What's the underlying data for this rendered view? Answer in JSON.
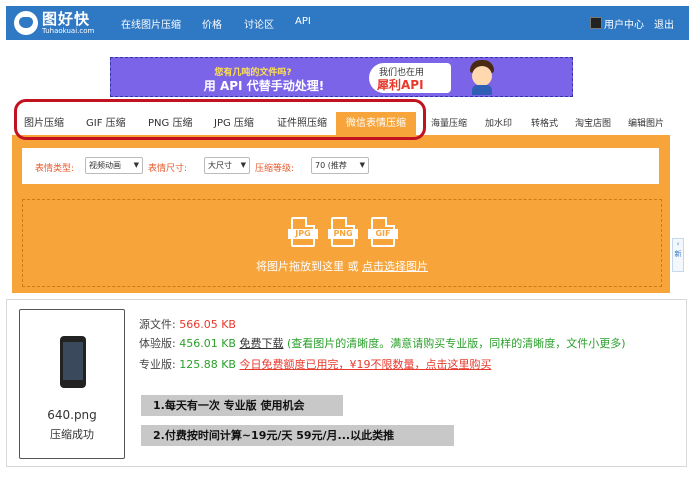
{
  "header": {
    "logo": {
      "name": "图好快",
      "domain": "Tuhaokuai.com"
    },
    "nav": [
      "在线图片压缩",
      "价格",
      "讨论区",
      "API"
    ],
    "user_center": "用户中心",
    "logout": "退出"
  },
  "banner": {
    "line1": "您有几吨的文件吗?",
    "line2": "用 API 代替手动处理!",
    "right_line1": "我们也在用",
    "right_line2": "犀利API"
  },
  "tabs": {
    "items": [
      "图片压缩",
      "GIF 压缩",
      "PNG 压缩",
      "JPG 压缩",
      "证件照压缩",
      "微信表情压缩",
      "海量压缩",
      "加水印",
      "转格式",
      "淘宝店图",
      "编辑图片"
    ],
    "active_index": 5
  },
  "options": {
    "type_label": "表情类型:",
    "type_value": "视频动画",
    "size_label": "表情尺寸:",
    "size_value": "大尺寸",
    "level_label": "压缩等级:",
    "level_value": "70 (推荐"
  },
  "dropzone": {
    "formats": [
      "JPG",
      "PNG",
      "GIF"
    ],
    "text_prefix": "将图片拖放到这里 或 ",
    "link": "点击选择图片"
  },
  "side_widget": {
    "label": "新"
  },
  "result": {
    "filename": "640.png",
    "status": "压缩成功",
    "source_label": "源文件:",
    "source_size": "566.05 KB",
    "trial_label": "体验版:",
    "trial_size": "456.01 KB",
    "trial_download": "免费下载",
    "trial_note": "(查看图片的清晰度。满意请购买专业版，同样的清晰度，文件小更多)",
    "pro_label": "专业版:",
    "pro_size": "125.88 KB",
    "pro_note": "今日免费额度已用完，¥19不限数量，点击这里购买"
  },
  "annotations": [
    "1.每天有一次 专业版 使用机会",
    "2.付费按时间计算~19元/天  59元/月...以此类推"
  ],
  "colors": {
    "nav_blue": "#2f78c4",
    "orange": "#f7a43a",
    "highlight_red": "#c3121f",
    "red_text": "#e8392d",
    "green_text": "#2aa02a"
  }
}
